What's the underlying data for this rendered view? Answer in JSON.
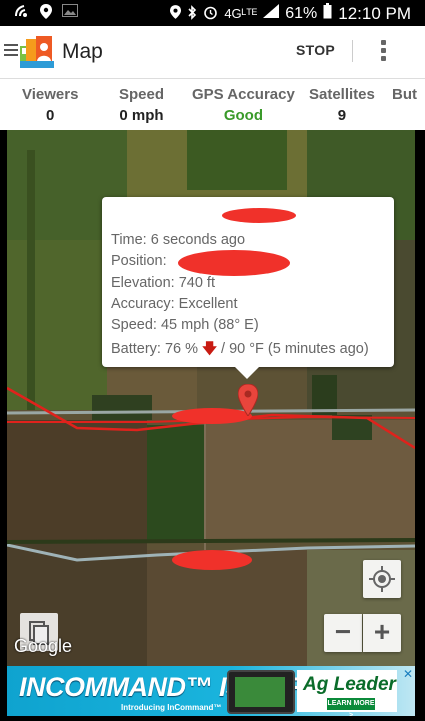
{
  "status_bar": {
    "network": "4Gᴸᵀᴱ",
    "battery_percent": "61%",
    "time": "12:10 PM"
  },
  "app_bar": {
    "title": "Map",
    "stop_label": "STOP"
  },
  "stats": [
    {
      "label": "Viewers",
      "value": "0"
    },
    {
      "label": "Speed",
      "value": "0 mph"
    },
    {
      "label": "GPS Accuracy",
      "value": "Good"
    },
    {
      "label": "Satellites",
      "value": "9"
    },
    {
      "label": "But",
      "value": ""
    }
  ],
  "info_window": {
    "time": "Time: 6 seconds ago",
    "position_label": "Position:",
    "elevation": "Elevation: 740 ft",
    "accuracy": "Accuracy: Excellent",
    "speed": "Speed: 45 mph (88° E)",
    "battery_prefix": "Battery: 76 %",
    "battery_suffix": " / 90 °F (5 minutes ago)"
  },
  "map": {
    "attribution": "Google",
    "zoom_in_label": "+",
    "zoom_out_label": "−"
  },
  "ad": {
    "headline": "INCOMMAND™ IS HERE.",
    "subline": "Introducing InCommand™",
    "brand": "Ag Leader",
    "cta": "LEARN MORE >",
    "close": "✕"
  }
}
